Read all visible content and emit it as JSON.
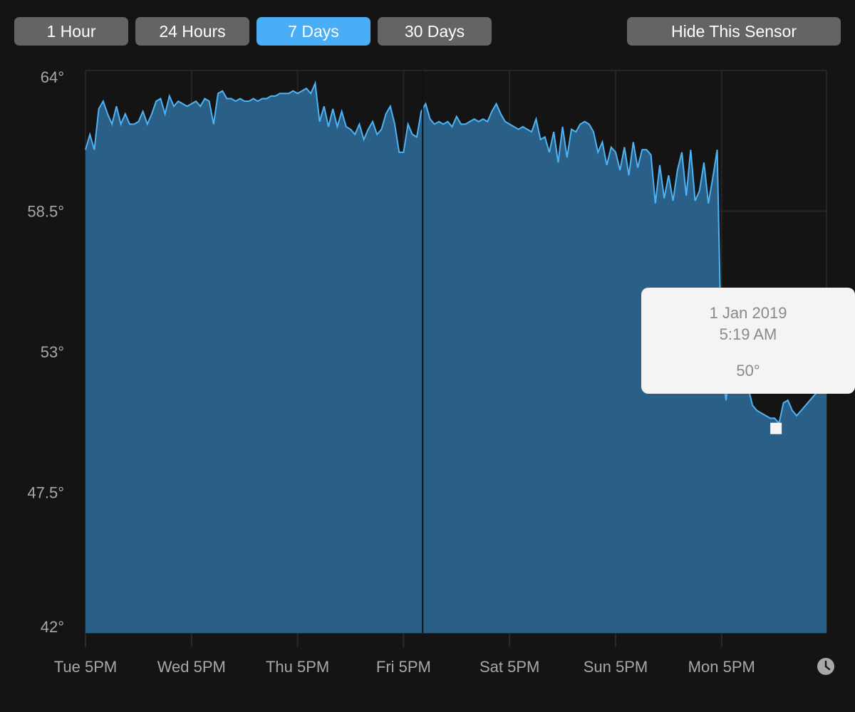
{
  "toolbar": {
    "ranges": [
      {
        "label": "1 Hour",
        "active": false
      },
      {
        "label": "24 Hours",
        "active": false
      },
      {
        "label": "7 Days",
        "active": true
      },
      {
        "label": "30 Days",
        "active": false
      }
    ],
    "hide_label": "Hide This Sensor"
  },
  "colors": {
    "accent": "#4aaef6",
    "button": "#646464",
    "fill": "#2a6088",
    "line": "#4db3f5",
    "background": "#141414"
  },
  "tooltip": {
    "date": "1 Jan 2019",
    "time": "5:19 AM",
    "value": "50°",
    "point": [
      "2019-01-01 05:19",
      50
    ]
  },
  "clock_icon": "clock-icon",
  "chart_data": {
    "type": "area",
    "ylim": [
      42,
      64
    ],
    "yticks": [
      64,
      58.5,
      53,
      47.5,
      42
    ],
    "ytick_labels": [
      "64°",
      "58.5°",
      "53°",
      "47.5°",
      "42°"
    ],
    "xlim": [
      "2018-12-25 17:00",
      "2019-01-01 16:45"
    ],
    "xticks": [
      "2018-12-25 17:00",
      "2018-12-26 17:00",
      "2018-12-27 17:00",
      "2018-12-28 17:00",
      "2018-12-29 17:00",
      "2018-12-30 17:00",
      "2018-12-31 17:00"
    ],
    "xtick_labels": [
      "Tue 5PM",
      "Wed 5PM",
      "Thu 5PM",
      "Fri 5PM",
      "Sat 5PM",
      "Sun 5PM",
      "Mon 5PM"
    ],
    "grid": true,
    "vline": "2018-12-28 21:20",
    "start": "2018-12-25 17:00",
    "interval": "1 hour",
    "values": [
      60.9,
      61.5,
      60.9,
      62.5,
      62.8,
      62.3,
      61.9,
      62.6,
      61.9,
      62.3,
      61.9,
      61.9,
      62.0,
      62.4,
      61.9,
      62.3,
      62.8,
      62.9,
      62.3,
      63.0,
      62.6,
      62.8,
      62.7,
      62.6,
      62.7,
      62.8,
      62.6,
      62.9,
      62.8,
      61.9,
      63.1,
      63.2,
      62.9,
      62.9,
      62.8,
      62.9,
      62.8,
      62.8,
      62.9,
      62.8,
      62.9,
      62.9,
      63.0,
      63.0,
      63.1,
      63.1,
      63.1,
      63.2,
      63.1,
      63.2,
      63.3,
      63.1,
      63.5,
      62.0,
      62.6,
      61.8,
      62.5,
      61.8,
      62.4,
      61.8,
      61.7,
      61.5,
      61.9,
      61.3,
      61.7,
      62.0,
      61.5,
      61.7,
      62.3,
      62.6,
      61.9,
      60.8,
      60.8,
      61.9,
      61.5,
      61.4,
      62.4,
      62.7,
      62.1,
      61.9,
      62.0,
      61.9,
      62.0,
      61.8,
      62.2,
      61.9,
      61.9,
      62.0,
      62.1,
      62.0,
      62.1,
      62.0,
      62.4,
      62.7,
      62.3,
      62.0,
      61.9,
      61.8,
      61.7,
      61.8,
      61.7,
      61.6,
      62.1,
      61.3,
      61.4,
      60.8,
      61.6,
      60.4,
      61.8,
      60.6,
      61.7,
      61.6,
      61.9,
      62.0,
      61.9,
      61.6,
      60.8,
      61.2,
      60.3,
      61.0,
      60.8,
      60.1,
      61.0,
      59.9,
      61.2,
      60.2,
      60.9,
      60.9,
      60.7,
      58.8,
      60.3,
      59.0,
      59.9,
      58.9,
      60.1,
      60.8,
      59.1,
      60.9,
      58.9,
      59.3,
      60.4,
      58.8,
      59.8,
      60.9,
      52.4,
      51.1,
      52.4,
      52.6,
      52.5,
      52.3,
      51.6,
      50.9,
      50.7,
      50.6,
      50.5,
      50.4,
      50.4,
      50.2,
      51.0,
      51.1,
      50.7,
      50.5,
      50.7,
      50.9,
      51.1,
      51.3,
      51.5,
      51.8
    ]
  }
}
